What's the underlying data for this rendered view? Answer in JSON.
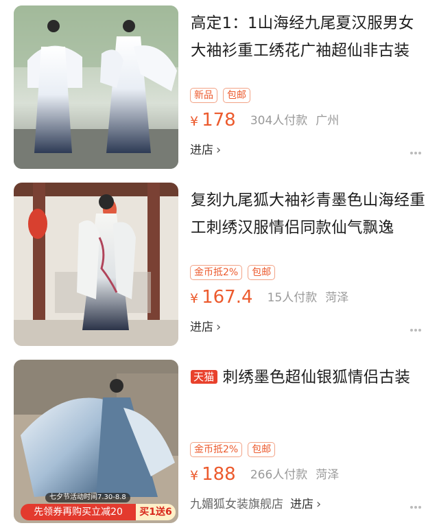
{
  "colors": {
    "price": "#ec5a2d",
    "tag_border": "#f2a285",
    "tmall_badge": "#e8412c",
    "meta_gray": "#999999"
  },
  "products": [
    {
      "title": "高定1：1山海经九尾夏汉服男女大袖衫重工绣花广袖超仙非古装",
      "tags": [
        "新品",
        "包邮"
      ],
      "currency": "¥",
      "price": "178",
      "sales": "304人付款",
      "location": "广州",
      "shop_name": "",
      "shop_link": "进店",
      "image": "hanfu-couple-garden-photo"
    },
    {
      "title": "复刻九尾狐大袖衫青墨色山海经重工刺绣汉服情侣同款仙气飘逸",
      "tags": [
        "金币抵2%",
        "包邮"
      ],
      "currency": "¥",
      "price": "167.4",
      "sales": "15人付款",
      "location": "菏泽",
      "shop_name": "",
      "shop_link": "进店",
      "image": "hanfu-back-view-pavilion-photo"
    },
    {
      "platform_badge": "天猫",
      "title": "刺绣墨色超仙银狐情侣古装",
      "tags": [
        "金币抵2%",
        "包邮"
      ],
      "currency": "¥",
      "price": "188",
      "sales": "266人付款",
      "location": "菏泽",
      "shop_name": "九媚狐女装旗舰店",
      "shop_link": "进店",
      "image": "hanfu-rocks-photo",
      "promo": {
        "event": "七夕节活动时间7.30-8.8",
        "coupon": "先领券再购买立减20",
        "offer": "买1送6"
      }
    }
  ]
}
